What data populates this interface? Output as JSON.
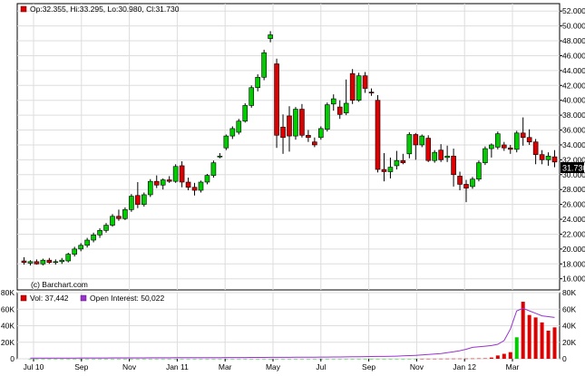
{
  "header": {
    "ohlc_label": "Op:32.355, Hi:33.295, Lo:30.980, Cl:31.730",
    "copyright": "(c) Barchart.com"
  },
  "volume_header": {
    "vol_label": "Vol: 37,442",
    "oi_label": "Open Interest: 50,022"
  },
  "colors": {
    "up": "#00cc00",
    "down": "#dd0000",
    "open_interest": "#9933cc",
    "grid": "#dddddd",
    "last_price_bg": "#000000"
  },
  "chart_data": [
    {
      "type": "candlestick",
      "title": "",
      "xlabel": "",
      "ylabel": "",
      "ylim": [
        14.5,
        53
      ],
      "y_ticks": [
        "16.000",
        "18.000",
        "20.000",
        "22.000",
        "24.000",
        "26.000",
        "28.000",
        "30.000",
        "32.000",
        "34.000",
        "36.000",
        "38.000",
        "40.000",
        "42.000",
        "44.000",
        "46.000",
        "48.000",
        "50.000",
        "52.000"
      ],
      "x_ticks": [
        "Jul 10",
        "Sep",
        "Nov",
        "Jan 11",
        "Mar",
        "May",
        "Jul",
        "Sep",
        "Nov",
        "Jan 12",
        "Mar"
      ],
      "last_price_label": "31.730",
      "grid": true,
      "candles": [
        {
          "o": 18.4,
          "h": 18.9,
          "l": 17.9,
          "c": 18.2
        },
        {
          "o": 18.1,
          "h": 18.5,
          "l": 17.8,
          "c": 18.3
        },
        {
          "o": 18.3,
          "h": 18.6,
          "l": 17.9,
          "c": 18.0
        },
        {
          "o": 18.0,
          "h": 18.7,
          "l": 17.8,
          "c": 18.5
        },
        {
          "o": 18.5,
          "h": 18.8,
          "l": 18.0,
          "c": 18.2
        },
        {
          "o": 18.2,
          "h": 18.6,
          "l": 17.9,
          "c": 18.3
        },
        {
          "o": 18.3,
          "h": 18.8,
          "l": 18.0,
          "c": 18.5
        },
        {
          "o": 18.4,
          "h": 19.5,
          "l": 18.2,
          "c": 19.3
        },
        {
          "o": 19.3,
          "h": 20.3,
          "l": 19.0,
          "c": 20.0
        },
        {
          "o": 20.0,
          "h": 20.8,
          "l": 19.7,
          "c": 20.5
        },
        {
          "o": 20.5,
          "h": 21.5,
          "l": 20.2,
          "c": 21.2
        },
        {
          "o": 21.2,
          "h": 22.2,
          "l": 20.9,
          "c": 21.9
        },
        {
          "o": 21.9,
          "h": 22.8,
          "l": 21.5,
          "c": 22.5
        },
        {
          "o": 22.5,
          "h": 23.5,
          "l": 22.2,
          "c": 23.2
        },
        {
          "o": 23.2,
          "h": 24.7,
          "l": 23.0,
          "c": 24.4
        },
        {
          "o": 24.4,
          "h": 25.3,
          "l": 23.8,
          "c": 24.1
        },
        {
          "o": 24.1,
          "h": 25.6,
          "l": 23.9,
          "c": 25.3
        },
        {
          "o": 25.3,
          "h": 27.4,
          "l": 25.0,
          "c": 27.1
        },
        {
          "o": 27.2,
          "h": 29.0,
          "l": 25.5,
          "c": 26.0
        },
        {
          "o": 26.0,
          "h": 27.6,
          "l": 25.7,
          "c": 27.3
        },
        {
          "o": 27.3,
          "h": 29.4,
          "l": 27.0,
          "c": 29.1
        },
        {
          "o": 29.1,
          "h": 29.9,
          "l": 28.2,
          "c": 28.6
        },
        {
          "o": 28.6,
          "h": 29.5,
          "l": 28.0,
          "c": 29.3
        },
        {
          "o": 29.3,
          "h": 29.8,
          "l": 28.9,
          "c": 29.1
        },
        {
          "o": 29.1,
          "h": 31.4,
          "l": 28.9,
          "c": 31.1
        },
        {
          "o": 31.2,
          "h": 31.8,
          "l": 28.3,
          "c": 29.0
        },
        {
          "o": 29.0,
          "h": 29.6,
          "l": 27.9,
          "c": 28.3
        },
        {
          "o": 28.3,
          "h": 28.9,
          "l": 27.2,
          "c": 27.9
        },
        {
          "o": 27.9,
          "h": 29.2,
          "l": 27.6,
          "c": 29.0
        },
        {
          "o": 29.0,
          "h": 30.1,
          "l": 28.7,
          "c": 29.9
        },
        {
          "o": 29.9,
          "h": 31.9,
          "l": 29.6,
          "c": 31.6
        },
        {
          "o": 32.5,
          "h": 32.9,
          "l": 32.2,
          "c": 32.5
        },
        {
          "o": 33.6,
          "h": 35.4,
          "l": 33.3,
          "c": 35.2
        },
        {
          "o": 35.2,
          "h": 36.5,
          "l": 34.8,
          "c": 36.2
        },
        {
          "o": 35.7,
          "h": 37.5,
          "l": 35.4,
          "c": 37.2
        },
        {
          "o": 37.2,
          "h": 39.6,
          "l": 37.0,
          "c": 39.3
        },
        {
          "o": 39.3,
          "h": 42.0,
          "l": 39.0,
          "c": 41.7
        },
        {
          "o": 41.7,
          "h": 43.5,
          "l": 41.2,
          "c": 43.1
        },
        {
          "o": 43.1,
          "h": 46.8,
          "l": 42.7,
          "c": 46.4
        },
        {
          "o": 48.3,
          "h": 49.3,
          "l": 47.8,
          "c": 48.8
        },
        {
          "o": 44.9,
          "h": 45.6,
          "l": 33.6,
          "c": 35.3
        },
        {
          "o": 36.4,
          "h": 38.1,
          "l": 32.8,
          "c": 35.0
        },
        {
          "o": 37.9,
          "h": 39.2,
          "l": 33.1,
          "c": 35.2
        },
        {
          "o": 35.2,
          "h": 39.1,
          "l": 34.7,
          "c": 38.8
        },
        {
          "o": 38.8,
          "h": 39.5,
          "l": 35.0,
          "c": 35.3
        },
        {
          "o": 35.3,
          "h": 36.0,
          "l": 34.4,
          "c": 35.0
        },
        {
          "o": 34.4,
          "h": 35.0,
          "l": 33.7,
          "c": 34.0
        },
        {
          "o": 35.0,
          "h": 36.5,
          "l": 34.7,
          "c": 36.2
        },
        {
          "o": 36.1,
          "h": 39.7,
          "l": 35.8,
          "c": 39.4
        },
        {
          "o": 39.5,
          "h": 40.8,
          "l": 38.6,
          "c": 40.2
        },
        {
          "o": 39.1,
          "h": 40.0,
          "l": 37.5,
          "c": 38.1
        },
        {
          "o": 38.3,
          "h": 42.8,
          "l": 38.0,
          "c": 39.6
        },
        {
          "o": 43.6,
          "h": 44.2,
          "l": 39.5,
          "c": 40.0
        },
        {
          "o": 40.0,
          "h": 43.7,
          "l": 39.8,
          "c": 43.3
        },
        {
          "o": 43.3,
          "h": 43.8,
          "l": 41.0,
          "c": 41.6
        },
        {
          "o": 41.1,
          "h": 41.6,
          "l": 40.6,
          "c": 41.0
        },
        {
          "o": 40.0,
          "h": 40.7,
          "l": 30.3,
          "c": 30.7
        },
        {
          "o": 30.7,
          "h": 32.9,
          "l": 29.1,
          "c": 30.4
        },
        {
          "o": 30.4,
          "h": 32.3,
          "l": 29.5,
          "c": 31.0
        },
        {
          "o": 31.2,
          "h": 33.2,
          "l": 30.7,
          "c": 31.9
        },
        {
          "o": 31.9,
          "h": 32.8,
          "l": 31.4,
          "c": 31.6
        },
        {
          "o": 32.8,
          "h": 35.7,
          "l": 32.2,
          "c": 35.4
        },
        {
          "o": 35.4,
          "h": 35.6,
          "l": 32.0,
          "c": 34.0
        },
        {
          "o": 34.0,
          "h": 35.4,
          "l": 33.7,
          "c": 35.2
        },
        {
          "o": 34.9,
          "h": 35.3,
          "l": 31.7,
          "c": 31.9
        },
        {
          "o": 31.9,
          "h": 33.3,
          "l": 31.6,
          "c": 33.0
        },
        {
          "o": 33.3,
          "h": 34.1,
          "l": 31.7,
          "c": 32.0
        },
        {
          "o": 32.3,
          "h": 33.9,
          "l": 31.7,
          "c": 32.5
        },
        {
          "o": 32.5,
          "h": 33.5,
          "l": 28.4,
          "c": 30.0
        },
        {
          "o": 29.8,
          "h": 30.4,
          "l": 27.9,
          "c": 28.7
        },
        {
          "o": 28.7,
          "h": 29.3,
          "l": 26.3,
          "c": 28.2
        },
        {
          "o": 28.4,
          "h": 29.7,
          "l": 28.1,
          "c": 29.4
        },
        {
          "o": 29.4,
          "h": 31.9,
          "l": 29.1,
          "c": 31.6
        },
        {
          "o": 31.6,
          "h": 33.8,
          "l": 31.3,
          "c": 33.5
        },
        {
          "o": 33.5,
          "h": 34.2,
          "l": 32.3,
          "c": 34.0
        },
        {
          "o": 33.7,
          "h": 35.8,
          "l": 33.4,
          "c": 35.5
        },
        {
          "o": 34.0,
          "h": 34.4,
          "l": 33.2,
          "c": 33.6
        },
        {
          "o": 33.6,
          "h": 34.0,
          "l": 32.8,
          "c": 33.4
        },
        {
          "o": 33.4,
          "h": 35.9,
          "l": 33.0,
          "c": 35.6
        },
        {
          "o": 35.6,
          "h": 37.7,
          "l": 33.9,
          "c": 35.0
        },
        {
          "o": 35.0,
          "h": 36.1,
          "l": 34.0,
          "c": 34.4
        },
        {
          "o": 34.4,
          "h": 34.8,
          "l": 31.4,
          "c": 32.7
        },
        {
          "o": 32.7,
          "h": 33.3,
          "l": 31.4,
          "c": 32.0
        },
        {
          "o": 32.0,
          "h": 33.0,
          "l": 31.2,
          "c": 32.5
        },
        {
          "o": 32.4,
          "h": 33.3,
          "l": 31.0,
          "c": 31.7
        }
      ]
    },
    {
      "type": "bar",
      "title": "",
      "ylim": [
        0,
        80000
      ],
      "y_ticks": [
        "0",
        "20K",
        "40K",
        "60K",
        "80K"
      ],
      "volume_series": {
        "name": "Vol",
        "values": [
          50,
          50,
          50,
          50,
          50,
          50,
          50,
          50,
          50,
          50,
          50,
          50,
          50,
          50,
          50,
          50,
          50,
          50,
          50,
          50,
          50,
          50,
          50,
          50,
          50,
          50,
          50,
          50,
          50,
          50,
          50,
          50,
          50,
          50,
          50,
          50,
          50,
          50,
          50,
          50,
          50,
          50,
          50,
          50,
          50,
          50,
          50,
          50,
          50,
          50,
          50,
          50,
          50,
          50,
          50,
          50,
          50,
          50,
          50,
          50,
          50,
          50,
          80,
          100,
          120,
          150,
          180,
          220,
          260,
          300,
          350,
          420,
          500,
          1500,
          4000,
          6000,
          8000,
          26000,
          69000,
          53000,
          50000,
          44000,
          34000,
          38000
        ],
        "colors": [
          "up",
          "up",
          "up",
          "up",
          "up",
          "up",
          "up",
          "up",
          "up",
          "up",
          "up",
          "up",
          "up",
          "up",
          "up",
          "up",
          "up",
          "up",
          "up",
          "up",
          "up",
          "up",
          "up",
          "up",
          "up",
          "up",
          "up",
          "up",
          "up",
          "up",
          "up",
          "up",
          "up",
          "up",
          "up",
          "up",
          "up",
          "up",
          "up",
          "up",
          "up",
          "up",
          "up",
          "up",
          "up",
          "up",
          "up",
          "up",
          "up",
          "up",
          "up",
          "up",
          "up",
          "up",
          "up",
          "up",
          "up",
          "up",
          "up",
          "up",
          "up",
          "up",
          "down",
          "down",
          "down",
          "down",
          "down",
          "down",
          "down",
          "down",
          "down",
          "down",
          "down",
          "down",
          "down",
          "down",
          "down",
          "up",
          "down",
          "down",
          "down",
          "down",
          "down",
          "down"
        ]
      },
      "open_interest_series": {
        "name": "Open Interest",
        "values": [
          800,
          800,
          850,
          850,
          850,
          900,
          900,
          900,
          950,
          950,
          1000,
          1000,
          1000,
          1050,
          1050,
          1100,
          1100,
          1150,
          1150,
          1200,
          1200,
          1250,
          1250,
          1300,
          1300,
          1350,
          1350,
          1400,
          1400,
          1450,
          1450,
          1500,
          1500,
          1550,
          1550,
          1600,
          1600,
          1650,
          1700,
          1700,
          1750,
          1800,
          1850,
          1900,
          1950,
          2000,
          2050,
          2100,
          2150,
          2200,
          2300,
          2400,
          2500,
          2600,
          2700,
          2800,
          2900,
          3000,
          3200,
          3500,
          3800,
          4200,
          4600,
          5100,
          5700,
          6400,
          7300,
          8400,
          9800,
          11500,
          13800,
          14500,
          15200,
          16000,
          17500,
          22000,
          36000,
          58000,
          61000,
          58000,
          55000,
          52000,
          51000,
          50022
        ]
      }
    }
  ]
}
